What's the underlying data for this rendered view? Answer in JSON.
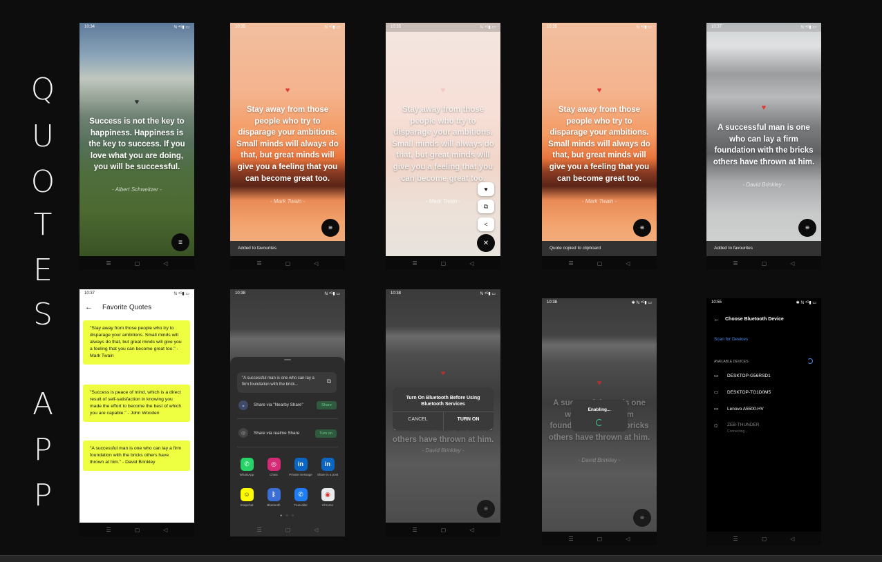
{
  "side_title": [
    "Q",
    "U",
    "O",
    "T",
    "E",
    "S",
    "A",
    "P",
    "P"
  ],
  "phones": {
    "p1": {
      "time": "10:34",
      "status_right": "ℕ ⁴ᴳ▮ ▭",
      "quote": "Success is not the key to happiness. Happiness is the key to success. If you love what you are doing, you will be successful.",
      "author": "- Albert Schweitzer -"
    },
    "p2": {
      "time": "10:35",
      "status_right": "ℕ ⁴ᴳ▮ ▭",
      "quote": "Stay away from those people who try to disparage your ambitions. Small minds will always do that, but great minds will give you a feeling that you can become great too.",
      "author": "- Mark Twain -",
      "snackbar": "Added to favourites"
    },
    "p3": {
      "time": "10:35",
      "status_right": "ℕ ⁴ᴳ▮ ▭",
      "quote": "Stay away from those people who try to disparage your ambitions. Small minds will always do that, but great minds will give you a feeling that you can become great too.",
      "author": "- Mark Twain -"
    },
    "p4": {
      "time": "10:35",
      "status_right": "ℕ ⁴ᴳ▮ ▭",
      "quote": "Stay away from those people who try to disparage your ambitions. Small minds will always do that, but great minds will give you a feeling that you can become great too.",
      "author": "- Mark Twain -",
      "snackbar": "Quote copied to clipboard"
    },
    "p5": {
      "time": "10:37",
      "status_right": "ℕ ⁴ᴳ▮ ▭",
      "quote": "A successful man is one who can lay a firm foundation with the bricks others have thrown at him.",
      "author": "- David Brinkley -",
      "snackbar": "Added to favourites"
    },
    "p6": {
      "time": "10:37",
      "status_right": "ℕ ⁴ᴳ▮ ▭",
      "title": "Favorite Quotes",
      "cards": [
        "\"Stay away from those people who try to disparage your ambitions. Small minds will always do that, but great minds will give you a feeling that you can become great too.\" - Mark Twain",
        "\"Success is peace of mind, which is a direct result of self-satisfaction in knowing you made the effort to become the best of which you are capable.\" - John Wooden",
        "\"A successful man is one who can lay a firm foundation with the bricks others have thrown at him.\" - David Brinkley"
      ]
    },
    "p7": {
      "time": "10:38",
      "status_right": "ℕ ⁴ᴳ▮ ▭",
      "preview": "\"A successful man is one who can lay a firm foundation with the brick...",
      "nearby_label": "Share via \"Nearby Share\"",
      "nearby_button": "Share",
      "realme_label": "Share via realme Share",
      "realme_button": "Turn on",
      "apps": [
        {
          "name": "WhatsApp",
          "glyph": "✆",
          "color": "#25d366"
        },
        {
          "name": "Chats",
          "glyph": "◎",
          "color": "#d62976"
        },
        {
          "name": "Private message",
          "glyph": "in",
          "color": "#0a66c2"
        },
        {
          "name": "Share in a post",
          "glyph": "in",
          "color": "#0a66c2"
        },
        {
          "name": "Snapchat",
          "glyph": "☺",
          "color": "#fffc00"
        },
        {
          "name": "Bluetooth",
          "glyph": "ᛒ",
          "color": "#3b6fd6"
        },
        {
          "name": "Truecaller",
          "glyph": "✆",
          "color": "#1f7cf2"
        },
        {
          "name": "Chrome",
          "glyph": "◉",
          "color": "#e8eaed"
        }
      ]
    },
    "p8": {
      "time": "10:38",
      "status_right": "ℕ ⁴ᴳ▮ ▭",
      "dialog_title": "Turn On Bluetooth Before Using Bluetooth Services",
      "cancel": "CANCEL",
      "turn_on": "TURN ON",
      "behind_quote": "A successful man is one who can lay a firm foundation with the bricks others have thrown at him.",
      "author": "- David Brinkley -"
    },
    "p9": {
      "time": "10:38",
      "status_right": "✱ ℕ ⁴ᴳ▮ ▭",
      "enabling": "Enabling...",
      "behind_quote": "A successful man is one who can lay a firm foundation with the bricks others have thrown at him.",
      "author": "- David Brinkley -"
    },
    "p10": {
      "time": "10:55",
      "status_right": "✱ ℕ ⁴ᴳ▮ ▭",
      "title": "Choose Bluetooth Device",
      "scan": "Scan for Devices",
      "section": "AVAILABLE DEVICES",
      "devices": [
        {
          "name": "DESKTOP-G56RSD1",
          "sub": ""
        },
        {
          "name": "DESKTOP-TG1D0M5",
          "sub": ""
        },
        {
          "name": "Lenovo A5500-HV",
          "sub": ""
        },
        {
          "name": "ZEB-THUNDER",
          "sub": "Connecting..."
        }
      ]
    }
  },
  "colors": {
    "heart": "#e53935",
    "accent_blue": "#4d8ef0",
    "fav_card": "#eeff41"
  },
  "icons": {
    "menu": "≡",
    "heart": "♥",
    "copy": "⧉",
    "share": "<",
    "close": "✕",
    "back": "←",
    "nav": [
      "☰",
      "▢",
      "◁"
    ]
  }
}
